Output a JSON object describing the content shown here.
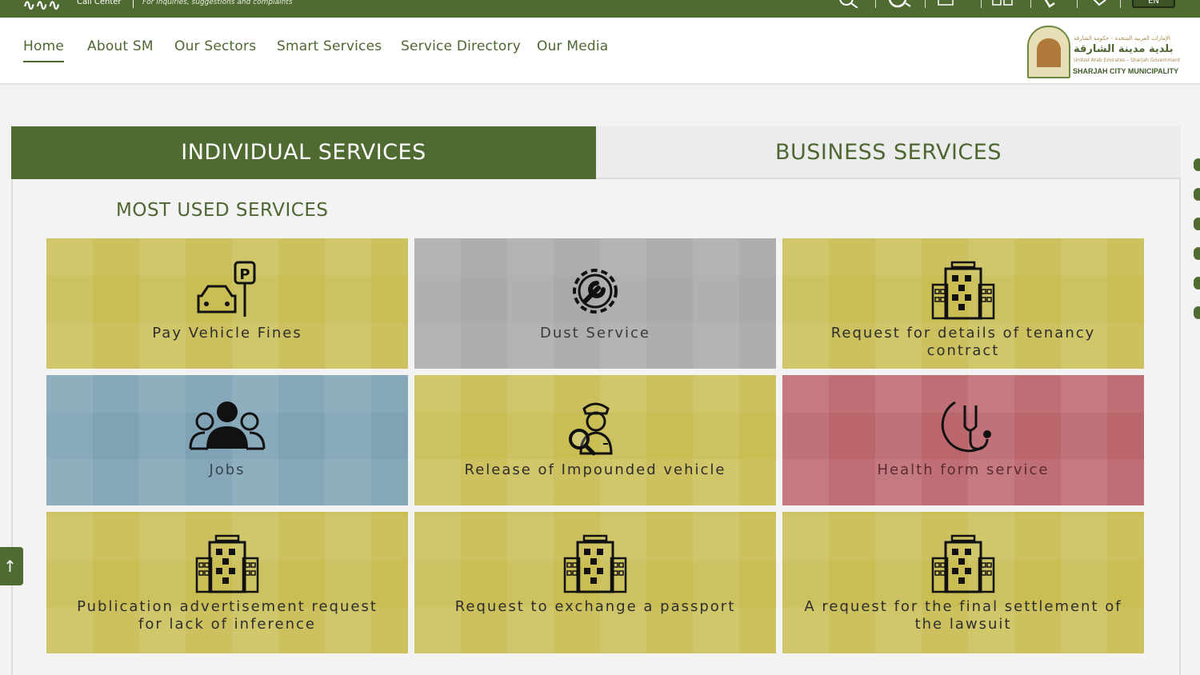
{
  "topbar": {
    "call_center_logo": "∿∿∿",
    "call_center_label": "Call Center",
    "call_center_tagline": "For inquiries, suggestions and complaints",
    "lang_label": "EN",
    "icons": [
      "search-icon",
      "accessibility-icon",
      "mail-icon",
      "sitemap-icon",
      "phone-icon",
      "location-icon"
    ]
  },
  "nav": {
    "items": [
      {
        "label": "Home"
      },
      {
        "label": "About SM"
      },
      {
        "label": "Our Sectors"
      },
      {
        "label": "Smart Services"
      },
      {
        "label": "Service Directory"
      },
      {
        "label": "Our Media"
      }
    ],
    "active_index": 0
  },
  "logo": {
    "arabic_top": "الإمارات العربية المتحدة - حكومة الشارقة",
    "arabic_main": "بلدية مدينة الشارقة",
    "arabic_sub": "United Arab Emirates – Sharjah Government",
    "english": "SHARJAH CITY MUNICIPALITY"
  },
  "tabs": {
    "individual": "INDIVIDUAL SERVICES",
    "business": "BUSINESS SERVICES"
  },
  "section_title": "MOST USED SERVICES",
  "services": [
    {
      "label": "Pay Vehicle Fines",
      "icon": "car-parking-icon",
      "color": "#c9bd54"
    },
    {
      "label": "Dust Service",
      "icon": "wrench-gear-icon",
      "color": "#a9a9a9"
    },
    {
      "label": "Request for details of tenancy contract",
      "icon": "building-icon",
      "color": "#c9bd54"
    },
    {
      "label": "Jobs",
      "icon": "people-icon",
      "color": "#7fa3b5"
    },
    {
      "label": "Release of Impounded vehicle",
      "icon": "inspector-icon",
      "color": "#c9bd54"
    },
    {
      "label": "Health form service",
      "icon": "stethoscope-crescent-icon",
      "color": "#bb666c"
    },
    {
      "label": "Publication advertisement request for lack of inference",
      "icon": "building-icon",
      "color": "#c9bd54"
    },
    {
      "label": "Request to exchange a passport",
      "icon": "building-icon",
      "color": "#c9bd54"
    },
    {
      "label": "A request for the final settlement of the lawsuit",
      "icon": "building-icon",
      "color": "#c9bd54"
    }
  ],
  "back_to_top": "↑"
}
